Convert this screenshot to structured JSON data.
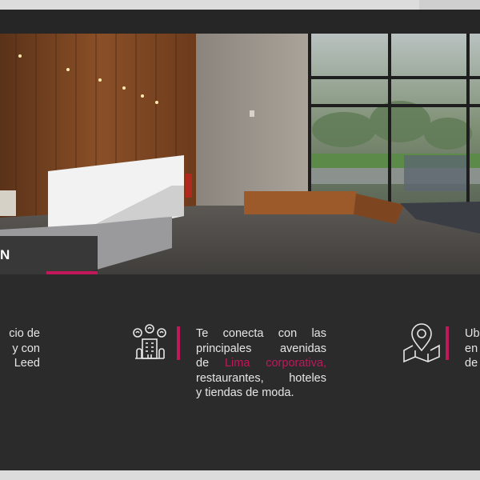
{
  "hero": {
    "title_fragment": "N"
  },
  "features": [
    {
      "lines": [
        "cio de",
        "y con",
        "Leed"
      ]
    },
    {
      "icon": "building-people-icon",
      "lines_before": [
        "Te conecta con las",
        "principales avenidas"
      ],
      "line3_prefix": "de ",
      "highlight": "Lima corporativa,",
      "lines_after": [
        "restaurantes, hoteles",
        "y tiendas de moda."
      ]
    },
    {
      "icon": "map-pin-icon",
      "lines": [
        "Ub",
        "en",
        "de"
      ]
    }
  ],
  "colors": {
    "accent": "#c0185a",
    "background": "#2b2b2b",
    "text": "#e6e6e6"
  }
}
